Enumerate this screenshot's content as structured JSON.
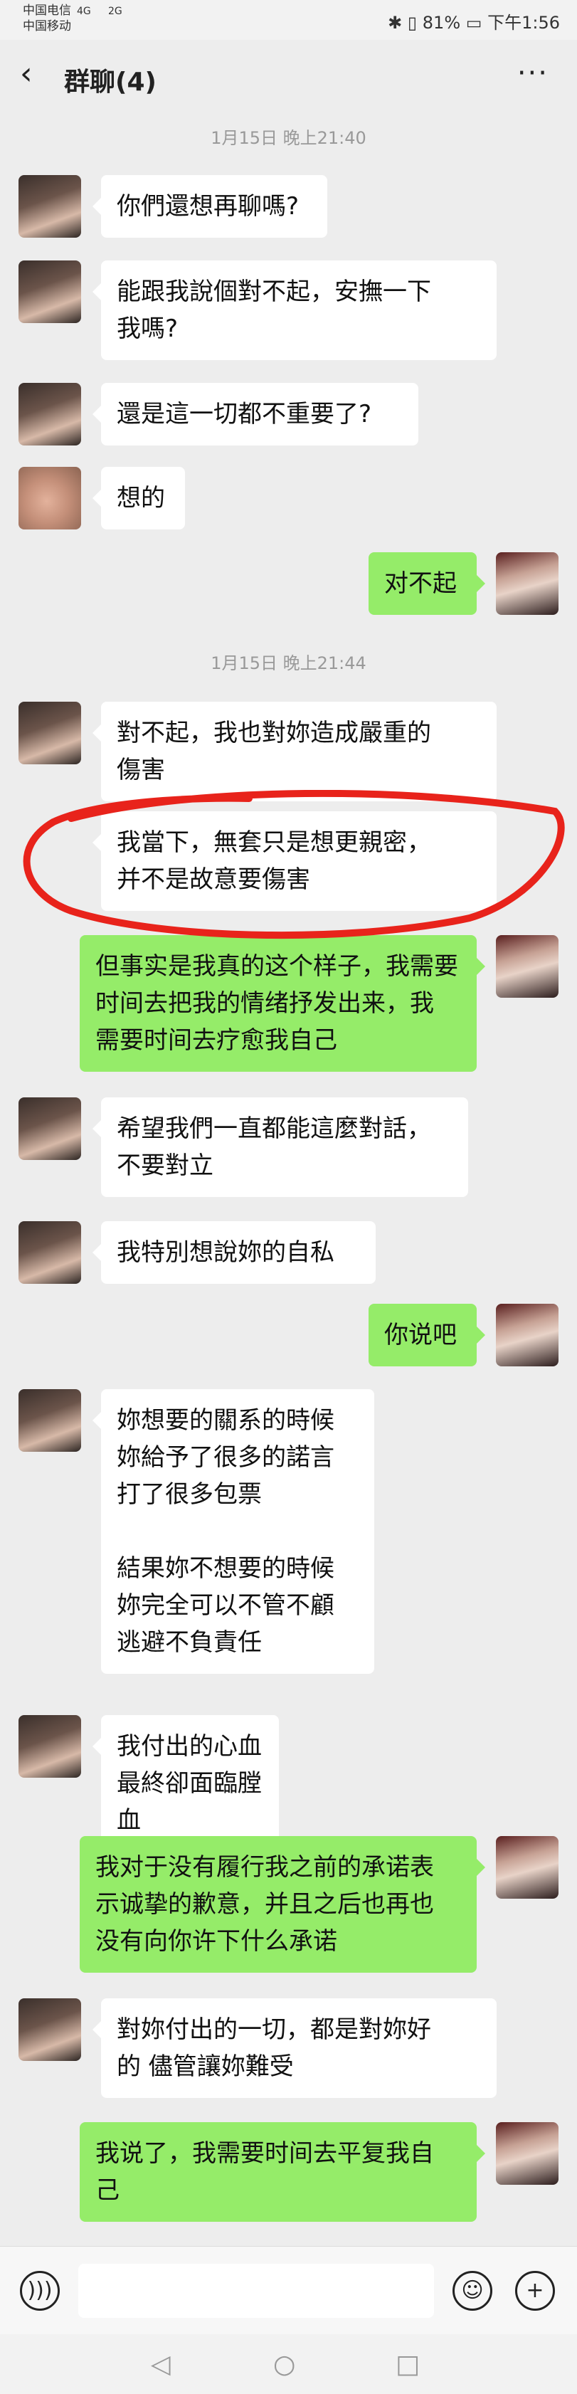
{
  "status_bar": {
    "carrier_1": "中国电信",
    "carrier_2": "中国移动",
    "signal_1": "4G",
    "signal_2": "2G",
    "battery": "81%",
    "time": "下午1:56"
  },
  "header": {
    "back_icon": "chevron-left-icon",
    "title": "群聊(4)",
    "more_icon": "more-icon"
  },
  "timestamps": [
    "1月15日 晚上21:40",
    "1月15日 晚上21:44"
  ],
  "messages": [
    {
      "side": "left",
      "avatar": "woman-long-hair",
      "text": "你們還想再聊嗎?"
    },
    {
      "side": "left",
      "avatar": "woman-long-hair",
      "text": "能跟我說個對不起，安撫一下\n我嗎?"
    },
    {
      "side": "left",
      "avatar": "woman-long-hair",
      "text": "還是這一切都不重要了?"
    },
    {
      "side": "left",
      "avatar": "face-closeup",
      "text": "想的"
    },
    {
      "side": "right",
      "avatar": "woman-short-hair",
      "text": "对不起"
    },
    {
      "side": "left",
      "avatar": "woman-long-hair",
      "text": "對不起，我也對妳造成嚴重的\n傷害"
    },
    {
      "side": "left",
      "avatar": "none",
      "text": "我當下，無套只是想更親密，\n并不是故意要傷害"
    },
    {
      "side": "right",
      "avatar": "woman-short-hair",
      "text": "但事实是我真的这个样子，我需要\n时间去把我的情绪抒发出来，我\n需要时间去疗愈我自己"
    },
    {
      "side": "left",
      "avatar": "woman-long-hair",
      "text": "希望我們一直都能這麼對話，\n不要對立"
    },
    {
      "side": "left",
      "avatar": "woman-long-hair",
      "text": "我特別想說妳的自私"
    },
    {
      "side": "right",
      "avatar": "woman-short-hair",
      "text": "你说吧"
    },
    {
      "side": "left",
      "avatar": "woman-long-hair",
      "text": "妳想要的關系的時候\n妳給予了很多的諾言\n打了很多包票\n\n結果妳不想要的時候\n妳完全可以不管不顧\n逃避不負責任"
    },
    {
      "side": "left",
      "avatar": "woman-long-hair",
      "text": "我付出的心血\n最終卻面臨膛血"
    },
    {
      "side": "right",
      "avatar": "woman-short-hair",
      "text": "我对于没有履行我之前的承诺表\n示诚挚的歉意，并且之后也再也\n没有向你许下什么承诺"
    },
    {
      "side": "left",
      "avatar": "woman-long-hair",
      "text": "對妳付出的一切，都是對妳好\n的 儘管讓妳難受"
    },
    {
      "side": "right",
      "avatar": "woman-short-hair",
      "text": "我说了，我需要时间去平复我自\n己"
    }
  ],
  "annotation": {
    "type": "hand-drawn-circle",
    "color": "#e8231b"
  },
  "input_bar": {
    "voice_icon": "voice-icon",
    "emoji_icon": "emoji-icon",
    "add_icon": "plus-icon"
  },
  "nav_bar": {
    "back": "◁",
    "home": "○",
    "recent": "□"
  }
}
